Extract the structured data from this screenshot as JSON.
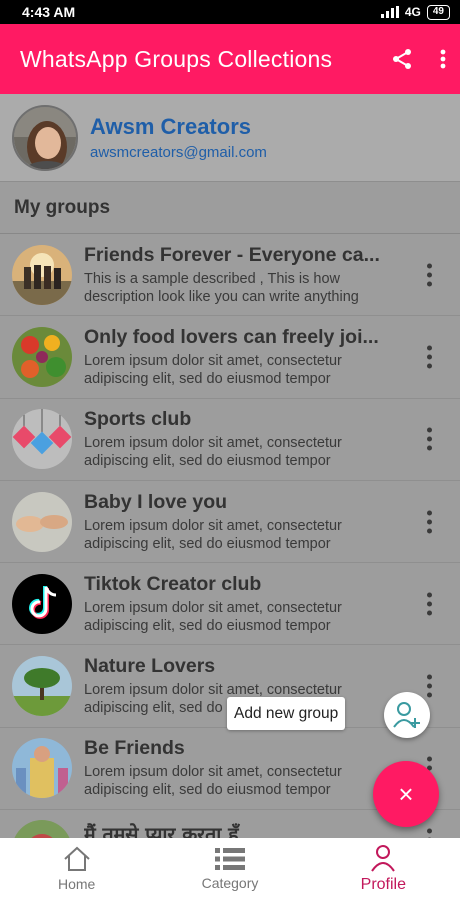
{
  "status_bar": {
    "time": "4:43 AM",
    "network": "4G",
    "battery": "49"
  },
  "app_bar": {
    "title": "WhatsApp Groups Collections",
    "share_icon": "share-icon",
    "menu_icon": "more-vert-icon"
  },
  "profile": {
    "name": "Awsm Creators",
    "email": "awsmcreators@gmail.com"
  },
  "section_title": "My groups",
  "groups": [
    {
      "title": "Friends Forever - Everyone ca...",
      "description": "This is a sample described , This is how description look like you can write anything",
      "thumb": "friends-photo"
    },
    {
      "title": "Only food lovers can freely joi...",
      "description": "Lorem ipsum dolor sit amet, consectetur adipiscing elit, sed do eiusmod tempor",
      "thumb": "food-photo"
    },
    {
      "title": "Sports club",
      "description": "Lorem ipsum dolor sit amet, consectetur adipiscing elit, sed do eiusmod tempor",
      "thumb": "new-tags-photo"
    },
    {
      "title": "Baby I love you",
      "description": "Lorem ipsum dolor sit amet, consectetur adipiscing elit, sed do eiusmod tempor",
      "thumb": "hands-photo"
    },
    {
      "title": "Tiktok Creator club",
      "description": "Lorem ipsum dolor sit amet, consectetur adipiscing elit, sed do eiusmod tempor",
      "thumb": "tiktok-logo"
    },
    {
      "title": "Nature Lovers",
      "description": "Lorem ipsum dolor sit amet, consectetur adipiscing elit, sed do eiusmod tempor",
      "thumb": "tree-photo"
    },
    {
      "title": "Be Friends",
      "description": "Lorem ipsum dolor sit amet, consectetur adipiscing elit, sed do eiusmod tempor",
      "thumb": "friends-art-photo"
    },
    {
      "title": "मैं तमसे प्यार करता हूँ",
      "description": "",
      "thumb": "love-photo"
    }
  ],
  "fab": {
    "tooltip": "Add new group",
    "mini_icon": "add-person-icon",
    "main_icon": "close-icon",
    "main_label": "×"
  },
  "bottom_nav": [
    {
      "label": "Home",
      "icon": "home-icon",
      "active": false
    },
    {
      "label": "Category",
      "icon": "list-icon",
      "active": false
    },
    {
      "label": "Profile",
      "icon": "person-icon",
      "active": true
    }
  ],
  "colors": {
    "primary": "#ff1a63",
    "link": "#1f5ea8",
    "active_nav": "#c2185b"
  }
}
